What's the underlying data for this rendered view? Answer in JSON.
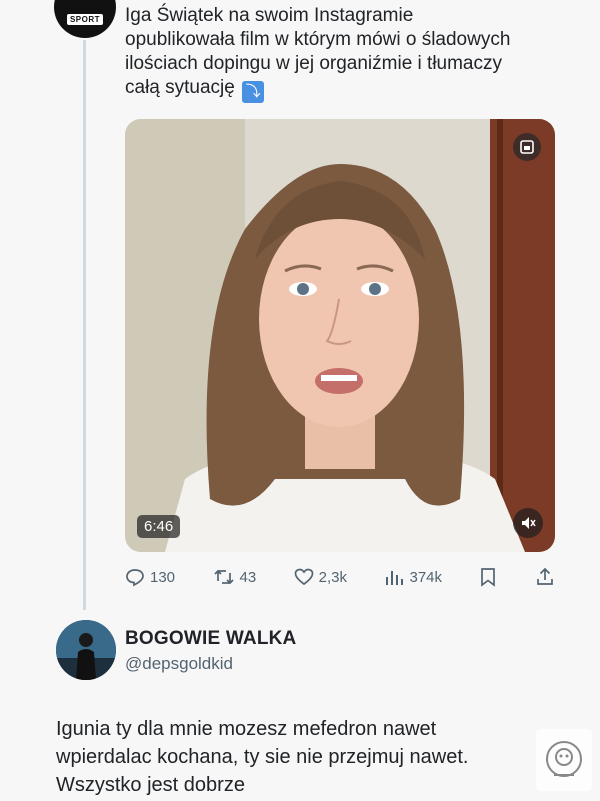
{
  "tweet": {
    "text": "Iga Świątek na swoim Instagramie opublikowała film w którym mówi o śladowych ilościach dopingu w jej organiźmie i tłumaczy całą sytuację",
    "emoji": "⤵",
    "avatar_logo_text": "SPORT"
  },
  "video": {
    "duration": "6:46"
  },
  "actions": {
    "replies": "130",
    "retweets": "43",
    "likes": "2,3k",
    "views": "374k"
  },
  "reply": {
    "name": "BOGOWIE WALKA",
    "handle": "@depsgoldkid",
    "text": "Igunia ty dla mnie mozesz mefedron nawet wpierdalac kochana, ty sie nie przejmuj nawet. Wszystko jest dobrze"
  },
  "colors": {
    "text": "#202327",
    "muted": "#536471",
    "thread_line": "#cfd9de"
  },
  "icons": [
    "pip-icon",
    "mute-icon",
    "reply-icon",
    "retweet-icon",
    "like-icon",
    "views-icon",
    "bookmark-icon",
    "share-icon",
    "watermark-icon"
  ]
}
